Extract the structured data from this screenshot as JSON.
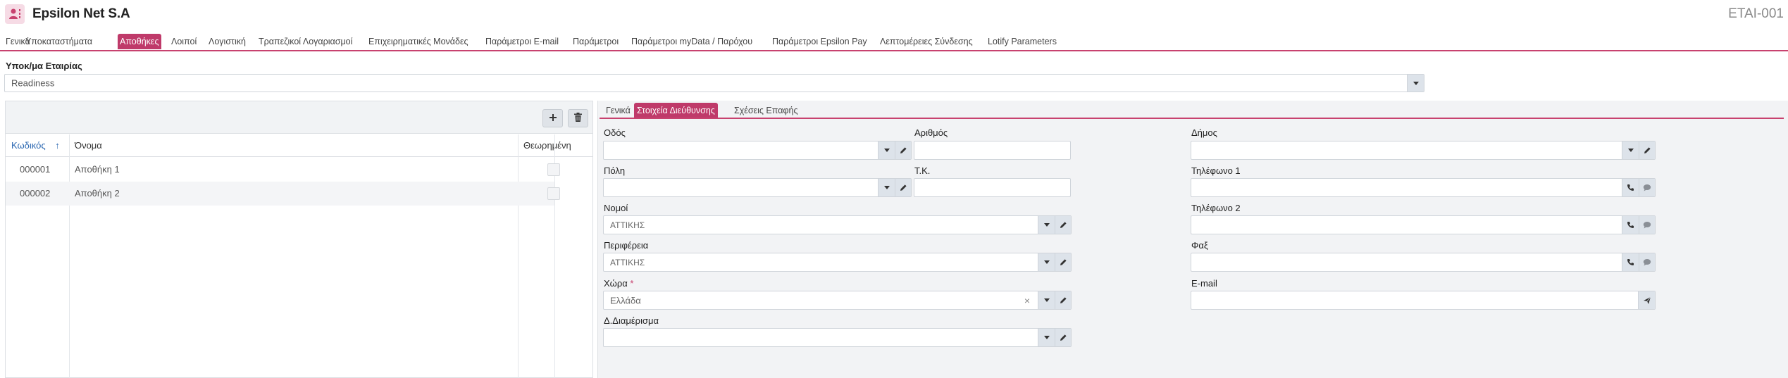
{
  "header": {
    "company_name": "Epsilon Net S.A",
    "form_code": "ETAI-001"
  },
  "main_tabs": [
    {
      "label": "Γενικά"
    },
    {
      "label": "Υποκαταστήματα"
    },
    {
      "label": "Αποθήκες"
    },
    {
      "label": "Λοιποί"
    },
    {
      "label": "Λογιστική"
    },
    {
      "label": "Τραπεζικοί Λογαριασμοί"
    },
    {
      "label": "Επιχειρηματικές Μονάδες"
    },
    {
      "label": "Παράμετροι E-mail"
    },
    {
      "label": "Παράμετροι"
    },
    {
      "label": "Παράμετροι myData / Παρόχου"
    },
    {
      "label": "Παράμετροι Epsilon Pay"
    },
    {
      "label": "Λεπτομέρειες Σύνδεσης"
    },
    {
      "label": "Lotify Parameters"
    }
  ],
  "active_main_tab": "Αποθήκες",
  "company_field": {
    "label": "Υποκ/μα Εταιρίας",
    "value": "Readiness"
  },
  "warehouse_grid": {
    "columns": [
      "Κωδικός",
      "Όνομα",
      "Θεωρημένη"
    ],
    "sort_indicator": "↑",
    "rows": [
      {
        "code": "000001",
        "name": "Αποθήκη 1",
        "certified": false
      },
      {
        "code": "000002",
        "name": "Αποθήκη 2",
        "certified": false
      }
    ]
  },
  "toolbar": {
    "add_icon": "plus-icon",
    "delete_icon": "trash-icon"
  },
  "sub_tabs": [
    {
      "label": "Γενικά"
    },
    {
      "label": "Στοιχεία Διεύθυνσης"
    },
    {
      "label": "Σχέσεις Επαφής"
    }
  ],
  "active_sub_tab": "Στοιχεία Διεύθυνσης",
  "address_form": {
    "street": {
      "label": "Οδός",
      "value": ""
    },
    "number": {
      "label": "Αριθμός",
      "value": ""
    },
    "municipality": {
      "label": "Δήμος",
      "value": ""
    },
    "city": {
      "label": "Πόλη",
      "value": ""
    },
    "postal_code": {
      "label": "Τ.Κ.",
      "value": ""
    },
    "phone1": {
      "label": "Τηλέφωνο 1",
      "value": ""
    },
    "prefecture": {
      "label": "Νομοί",
      "value": "ΑΤΤΙΚΗΣ"
    },
    "phone2": {
      "label": "Τηλέφωνο 2",
      "value": ""
    },
    "region": {
      "label": "Περιφέρεια",
      "value": "ΑΤΤΙΚΗΣ"
    },
    "fax": {
      "label": "Φαξ",
      "value": ""
    },
    "country": {
      "label": "Χώρα",
      "required_mark": "*",
      "value": "Ελλάδα"
    },
    "email": {
      "label": "E-mail",
      "value": ""
    },
    "district": {
      "label": "Δ.Διαμέρισμα",
      "value": ""
    }
  },
  "colors": {
    "accent": "#bf3a6a",
    "sorted_header": "#2a67b1",
    "button_bg": "#dde3ea"
  }
}
